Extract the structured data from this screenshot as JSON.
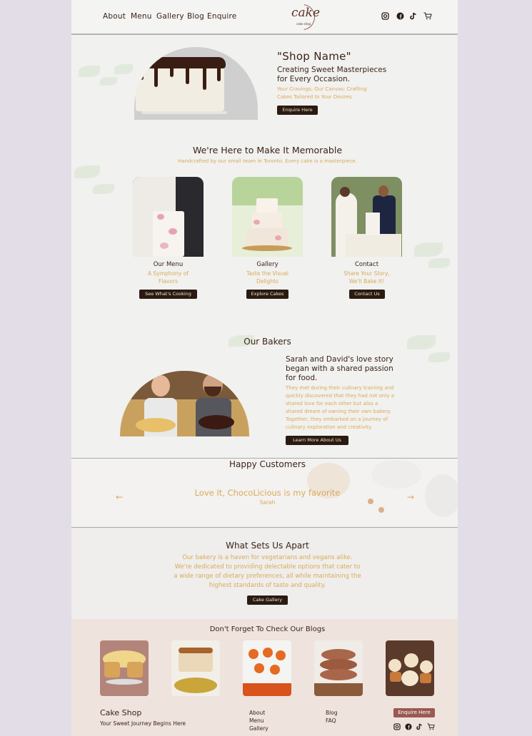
{
  "nav": {
    "links": [
      "About",
      "Menu",
      "Gallery",
      "Blog",
      "Enquire"
    ],
    "logo_main": "cake",
    "logo_sub": "cake shop",
    "icons": [
      "instagram-icon",
      "facebook-icon",
      "tiktok-icon",
      "cart-icon"
    ]
  },
  "hero": {
    "shop_name": "\"Shop Name\"",
    "tagline_line1": "Creating Sweet Masterpieces",
    "tagline_line2": "for Every Occasion.",
    "sub_line1": "Your Cravings, Our Canvas: Crafting",
    "sub_line2": "Cakes Tailored to Your Desires",
    "button": "Enquire Here"
  },
  "memorable": {
    "title": "We're Here to Make It Memorable",
    "subtitle": "Handcrafted by our small team in Toronto. Every cake is a masterpiece.",
    "cards": [
      {
        "title": "Our Menu",
        "sub1": "A Symphony of",
        "sub2": "Flavors",
        "button": "See What's Cooking"
      },
      {
        "title": "Gallery",
        "sub1": "Taste the Visual",
        "sub2": "Delights",
        "button": "Explore Cakes"
      },
      {
        "title": "Contact",
        "sub1": "Share Your Story,",
        "sub2": "We'll Bake It!",
        "button": "Contact Us"
      }
    ]
  },
  "bakers": {
    "title": "Our Bakers",
    "heading_line1": "Sarah and David's love story",
    "heading_line2": "began with a shared passion",
    "heading_line3": "for food.",
    "body_lines": [
      "They met during their culinary training and",
      "quickly discovered that they had not only a",
      "shared love for each other but also a",
      "shared dream of owning their own bakery.",
      "Together, they embarked on a journey of",
      "culinary exploration and creativity."
    ],
    "button": "Learn More About Us"
  },
  "testimonials": {
    "title": "Happy Customers",
    "quote": "Love It, ChocoLicious is my favorite",
    "author": "Sarah",
    "prev": "←",
    "next": "→"
  },
  "apart": {
    "title": "What Sets Us Apart",
    "lines": [
      "Our bakery is a haven for vegetarians and vegans alike.",
      "We're dedicated to providing delectable options that cater to",
      "a wide range of dietary preferences, all while maintaining the",
      "highest standards of taste and quality."
    ],
    "button": "Cake Gallery"
  },
  "blogs": {
    "title": "Don't Forget To Check Our Blogs"
  },
  "footer": {
    "brand": "Cake Shop",
    "tagline": "Your Sweet Journey Begins Here",
    "col1": [
      "About",
      "Menu",
      "Gallery"
    ],
    "col2": [
      "Blog",
      "FAQ"
    ],
    "button": "Enquire Here"
  },
  "colors": {
    "accent_gold": "#d9aa5a",
    "dark_brown": "#2a1a12",
    "footer_button": "#9a5a52",
    "outer_bg": "#e3dde8",
    "page_bg": "#f1f1ef",
    "footer_bg": "#efe3de"
  }
}
